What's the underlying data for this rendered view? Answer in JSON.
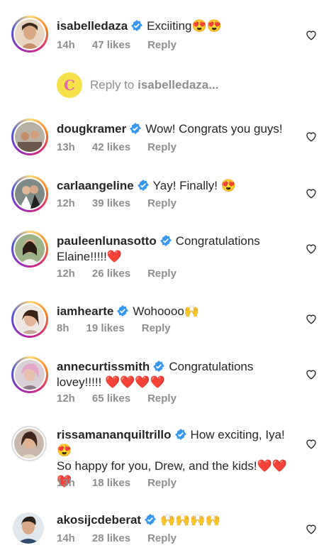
{
  "comments": [
    {
      "user": "isabelledaza",
      "text": "Exciiting",
      "emoji": "😍😍",
      "time": "14h",
      "likes": "47 likes",
      "reply": "Reply",
      "ring": "gradient"
    },
    {
      "user": "dougkramer",
      "text": "Wow! Congrats you guys!",
      "emoji": "",
      "time": "13h",
      "likes": "42 likes",
      "reply": "Reply",
      "ring": "gradient"
    },
    {
      "user": "carlaangeline",
      "text": "Yay! Finally!",
      "emoji": "😍",
      "time": "12h",
      "likes": "39 likes",
      "reply": "Reply",
      "ring": "gradient"
    },
    {
      "user": "pauleenlunasotto",
      "text": "Congratulations Elaine!!!!!",
      "emoji": "❤️",
      "time": "12h",
      "likes": "26 likes",
      "reply": "Reply",
      "ring": "gradient"
    },
    {
      "user": "iamhearte",
      "text": "Wohoooo",
      "emoji": "🙌",
      "time": "8h",
      "likes": "19 likes",
      "reply": "Reply",
      "ring": "gradient"
    },
    {
      "user": "annecurtissmith",
      "text": "Congratulations lovey!!!!!",
      "emoji": "❤️❤️❤️❤️",
      "time": "12h",
      "likes": "65 likes",
      "reply": "Reply",
      "ring": "gradient"
    },
    {
      "user": "rissamananquiltrillo",
      "text": "How exciting, Iya!",
      "emoji": "😍",
      "text2": "So happy for you, Drew, and the kids!",
      "emoji2": "❤️❤️",
      "emoji3": "❤️",
      "time": "13h",
      "likes": "18 likes",
      "reply": "Reply",
      "ring": "plain"
    },
    {
      "user": "akosijcdeberat",
      "text": "",
      "emoji": "🙌🙌🙌🙌",
      "time": "14h",
      "likes": "28 likes",
      "reply": "Reply",
      "ring": "none"
    }
  ],
  "reply_bar": {
    "prefix": "Reply to ",
    "target": "isabelledaza...",
    "avatar_letter": "C"
  },
  "colors": {
    "verified": "#3897f0",
    "meta": "#8e8e8e",
    "heart": "#ed4956"
  }
}
